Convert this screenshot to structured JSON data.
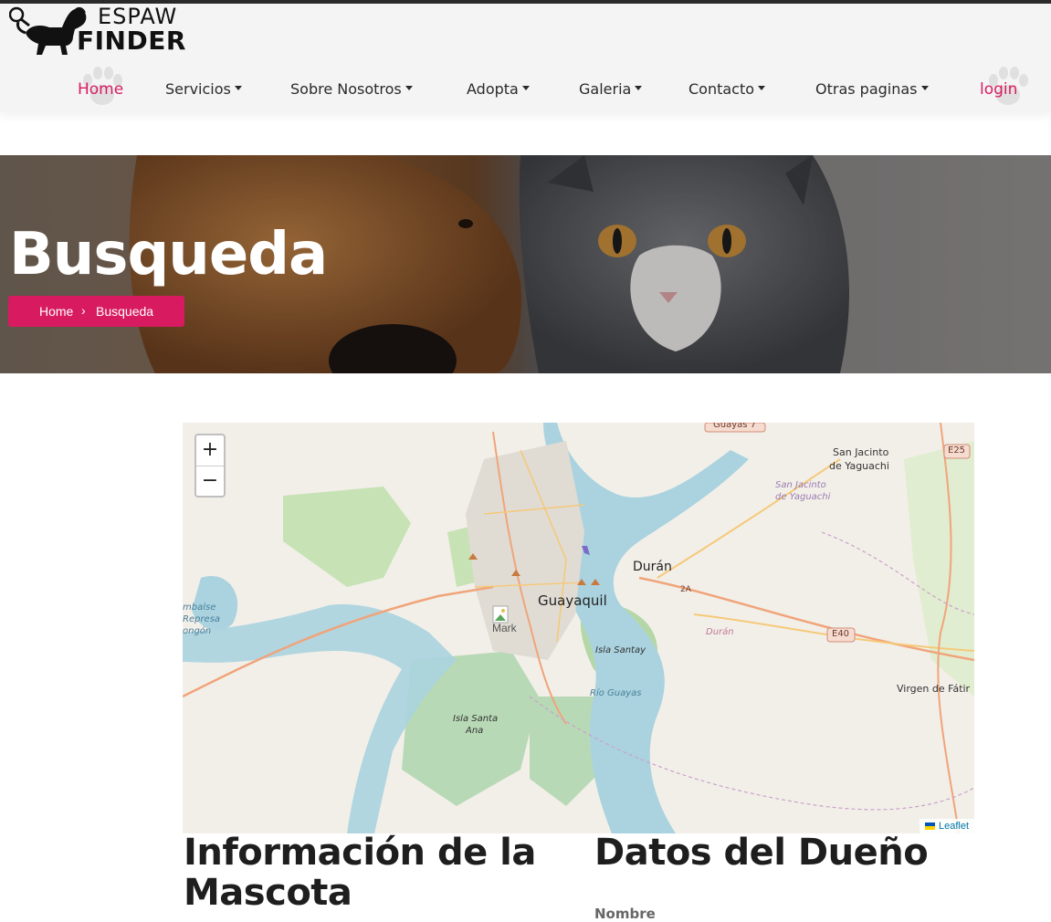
{
  "logo": {
    "line1": "ESPAW",
    "line2": "FINDER",
    "icon": "dog-magnifier-logo"
  },
  "nav": {
    "items": [
      {
        "label": "Home",
        "active": true
      },
      {
        "label": "Servicios",
        "dropdown": true
      },
      {
        "label": "Sobre Nosotros",
        "dropdown": true
      },
      {
        "label": "Adopta",
        "dropdown": true
      },
      {
        "label": "Galeria",
        "dropdown": true
      },
      {
        "label": "Contacto",
        "dropdown": true
      },
      {
        "label": "Otras paginas",
        "dropdown": true
      }
    ],
    "login": "login"
  },
  "hero": {
    "title": "Busqueda",
    "breadcrumb": {
      "home": "Home",
      "separator": "›",
      "current": "Busqueda"
    }
  },
  "map": {
    "zoom_in": "+",
    "zoom_out": "−",
    "attribution": "Leaflet",
    "marker_alt": "Mark",
    "labels": {
      "guayaquil": "Guayaquil",
      "duran": "Durán",
      "duran_river": "Durán",
      "san_jacinto_1": "San Jacinto",
      "san_jacinto_2": "de Yaguachi",
      "sj_italic_1": "San Jacinto",
      "sj_italic_2": "de Yaguachi",
      "isla_santay": "Isla Santay",
      "rio_guayas": "Río Guayas",
      "isla_santa_1": "Isla Santa",
      "isla_santa_2": "Ana",
      "virgen": "Virgen de Fátir",
      "e25": "E25",
      "e40": "E40",
      "a2": "2A",
      "guayas7": "Guayas 7",
      "embalse_1": "mbalse",
      "embalse_2": "Represa",
      "embalse_3": "ongón"
    }
  },
  "sections": {
    "mascota": "Información de la Mascota",
    "dueno": "Datos del Dueño",
    "nombre": "Nombre"
  },
  "colors": {
    "accent": "#d81b60",
    "nav_bg": "#f4f4f4"
  }
}
